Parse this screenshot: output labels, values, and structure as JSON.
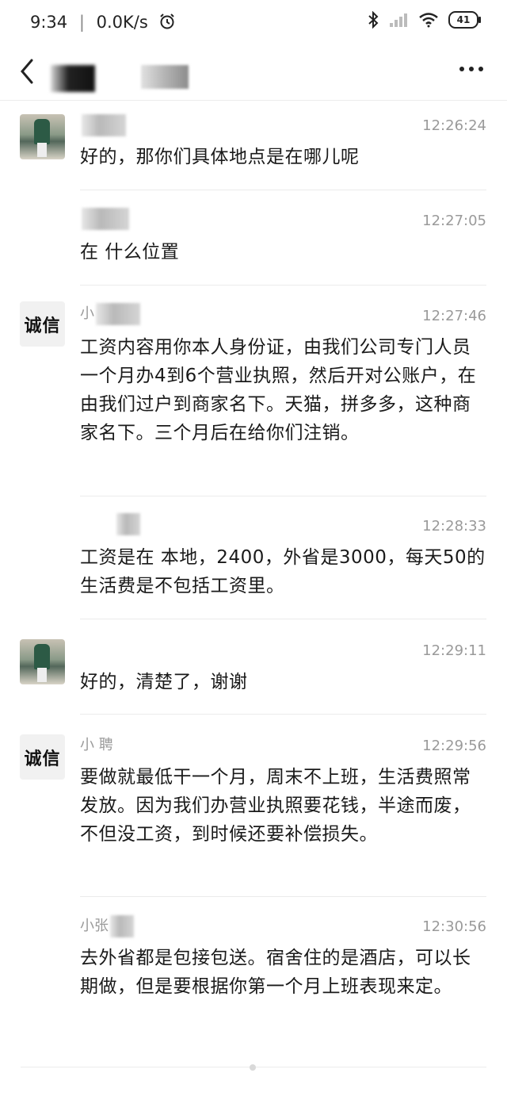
{
  "status_bar": {
    "time": "9:34",
    "network_speed": "0.0K/s",
    "battery": "41"
  },
  "header": {
    "back_icon": "chevron-left-icon",
    "more_icon": "more-dots-icon"
  },
  "messages": [
    {
      "sender": "",
      "time": "12:26:24",
      "text": "好的，那你们具体地点是在哪儿呢",
      "avatar": "photo"
    },
    {
      "sender": "",
      "time": "12:27:05",
      "text": "在      什么位置",
      "avatar": "none"
    },
    {
      "sender": "小",
      "time": "12:27:46",
      "text": "工资内容用你本人身份证，由我们公司专门人员一个月办4到6个营业执照，然后开对公账户，在由我们过户到商家名下。天猫，拼多多，这种商家名下。三个月后在给你们注销。",
      "avatar": "seal",
      "avatar_text": "诚信"
    },
    {
      "sender": "",
      "time": "12:28:33",
      "text": "工资是在      本地，2400，外省是3000，每天50的生活费是不包括工资里。",
      "avatar": "none"
    },
    {
      "sender": "",
      "time": "12:29:11",
      "text": "好的，清楚了，谢谢",
      "avatar": "photo"
    },
    {
      "sender": "小      聘",
      "time": "12:29:56",
      "text": "要做就最低干一个月，周末不上班，生活费照常发放。因为我们办营业执照要花钱，半途而废，不但没工资，到时候还要补偿损失。",
      "avatar": "seal",
      "avatar_text": "诚信"
    },
    {
      "sender": "小张",
      "time": "12:30:56",
      "text": "去外省都是包接包送。宿舍住的是酒店，可以长期做，但是要根据你第一个月上班表现来定。",
      "avatar": "none"
    }
  ]
}
